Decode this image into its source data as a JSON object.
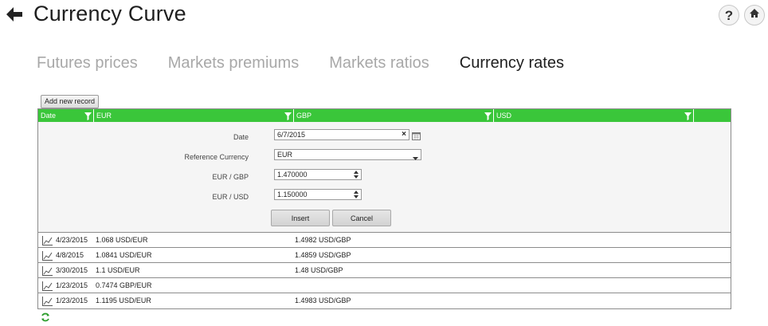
{
  "header": {
    "title": "Currency Curve"
  },
  "icons": {
    "back": "back-arrow-icon",
    "help": "help-icon",
    "home": "home-icon",
    "refresh": "refresh-icon",
    "chart": "line-chart-icon",
    "filter": "filter-icon",
    "calendar": "calendar-icon"
  },
  "tabs": [
    {
      "label": "Futures prices",
      "active": false
    },
    {
      "label": "Markets premiums",
      "active": false
    },
    {
      "label": "Markets ratios",
      "active": false
    },
    {
      "label": "Currency rates",
      "active": true
    }
  ],
  "toolbar": {
    "add_label": "Add new record"
  },
  "grid": {
    "columns": [
      "Date",
      "EUR",
      "GBP",
      "USD"
    ],
    "header_color": "#3ac63a",
    "form": {
      "date_label": "Date",
      "date_value": "6/7/2015",
      "ref_label": "Reference Currency",
      "ref_value": "EUR",
      "pair1_label": "EUR / GBP",
      "pair1_value": "1.470000",
      "pair2_label": "EUR / USD",
      "pair2_value": "1.150000",
      "insert_label": "Insert",
      "cancel_label": "Cancel"
    },
    "rows": [
      {
        "date": "4/23/2015",
        "eur": "1.068 USD/EUR",
        "gbp": "1.4982 USD/GBP",
        "usd": ""
      },
      {
        "date": "4/8/2015",
        "eur": "1.0841 USD/EUR",
        "gbp": "1.4859 USD/GBP",
        "usd": ""
      },
      {
        "date": "3/30/2015",
        "eur": "1.1 USD/EUR",
        "gbp": "1.48 USD/GBP",
        "usd": ""
      },
      {
        "date": "1/23/2015",
        "eur": "0.7474 GBP/EUR",
        "gbp": "",
        "usd": ""
      },
      {
        "date": "1/23/2015",
        "eur": "1.1195 USD/EUR",
        "gbp": "1.4983 USD/GBP",
        "usd": ""
      }
    ]
  }
}
